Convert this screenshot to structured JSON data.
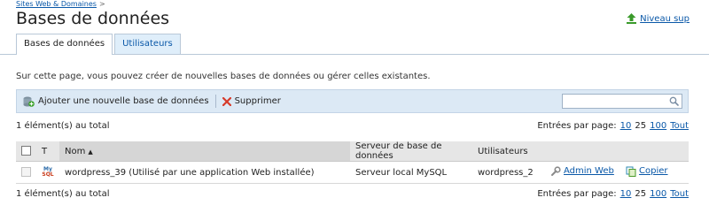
{
  "breadcrumb": {
    "link": "Sites Web & Domaines",
    "separator": ">"
  },
  "page_title": "Bases de données",
  "up_link": "Niveau sup",
  "tabs": [
    {
      "label": "Bases de données",
      "active": true
    },
    {
      "label": "Utilisateurs",
      "active": false
    }
  ],
  "intro_text": "Sur cette page, vous pouvez créer de nouvelles bases de données ou gérer celles existantes.",
  "toolbar": {
    "add_label": "Ajouter une nouvelle base de données",
    "delete_label": "Supprimer",
    "search_value": ""
  },
  "summary_top": "1 élément(s) au total",
  "summary_bottom": "1 élément(s) au total",
  "pager": {
    "label": "Entrées par page:",
    "options": [
      "10",
      "25",
      "100",
      "Tout"
    ],
    "current": "25"
  },
  "table": {
    "headers": {
      "type": "T",
      "name": "Nom",
      "server": "Serveur de base de données",
      "users": "Utilisateurs"
    },
    "rows": [
      {
        "type_icon": "mysql-icon",
        "name": "wordpress_39 (Utilisé par une application Web installée)",
        "server": "Serveur local MySQL",
        "user": "wordpress_2",
        "admin_label": "Admin Web",
        "copy_label": "Copier"
      }
    ]
  },
  "colors": {
    "accent": "#0a58a8",
    "toolbar_bg": "#dce9f5",
    "tab_bg": "#dfeefa",
    "header_bg": "#e6e6e6"
  }
}
